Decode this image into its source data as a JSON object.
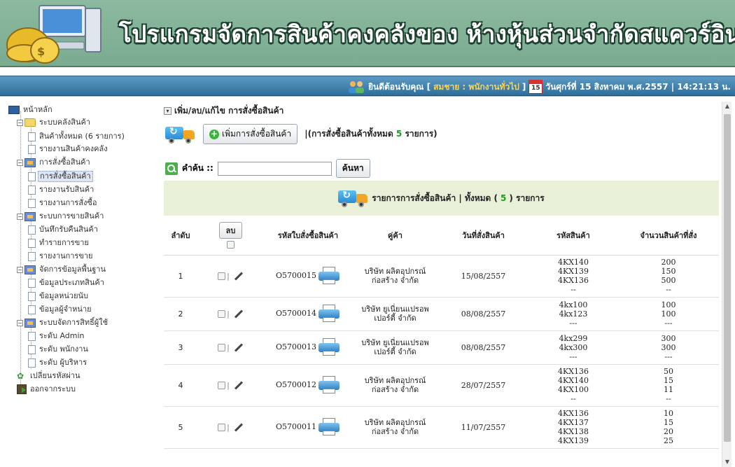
{
  "banner": {
    "title": "โปรแกรมจัดการสินค้าคงคลังของ ห้างหุ้นส่วนจำกัดสแควร์อินเตอร์เทรด"
  },
  "status": {
    "welcome_prefix": "ยินดีต้อนรับคุณ [",
    "user": "สมชาย : พนักงานทั่วไป",
    "welcome_suffix": "]",
    "calendar_day": "15",
    "datetime": "วันศุกร์ที่ 15 สิงหาคม พ.ศ.2557 | 14:21:13 น."
  },
  "sidebar": {
    "home": "หน้าหลัก",
    "groups": [
      {
        "label": "ระบบคลังสินค้า",
        "items": [
          "สินค้าทั้งหมด (6 รายการ)",
          "รายงานสินค้าคงคลัง"
        ]
      },
      {
        "label": "การสั่งซื้อสินค้า",
        "items": [
          "การสั่งซื้อสินค้า",
          "รายงานรับสินค้า",
          "รายงานการสั่งซื้อ"
        ]
      },
      {
        "label": "ระบบการขายสินค้า",
        "items": [
          "บันทึกรับคืนสินค้า",
          "ทำรายการขาย",
          "รายงานการขาย"
        ]
      },
      {
        "label": "จัดการข้อมูลพื้นฐาน",
        "items": [
          "ข้อมูลประเภทสินค้า",
          "ข้อมูลหน่วยนับ",
          "ข้อมูลผู้จำหน่าย"
        ]
      },
      {
        "label": "ระบบจัดการสิทธิ์ผู้ใช้",
        "items": [
          "ระดับ Admin",
          "ระดับ พนักงาน",
          "ระดับ ผู้บริหาร"
        ]
      }
    ],
    "change_password": "เปลี่ยนรหัสผ่าน",
    "logout": "ออกจากระบบ"
  },
  "main": {
    "breadcrumb": "เพิ่ม/ลบ/แก้ไข การสั่งซื้อสินค้า",
    "add_button": "เพิ่มการสั่งซื้อสินค้า",
    "count_prefix": "|(การสั่งซื้อสินค้าทั้งหมด",
    "count_value": "5",
    "count_suffix": "รายการ)",
    "search_label": "คำค้น ::",
    "search_value": "",
    "search_button": "ค้นหา",
    "panel_prefix": "รายการการสั่งซื้อสินค้า | ทั้งหมด (",
    "panel_count": "5",
    "panel_suffix": ") รายการ"
  },
  "table": {
    "headers": {
      "no": "ลำดับ",
      "delete": "ลบ",
      "order_id": "รหัสใบสั่งซื้อสินค้า",
      "partner": "คู่ค้า",
      "date": "วันที่สั่งสินค้า",
      "product": "รหัสสินค้า",
      "qty": "จำนวนสินค้าที่สั่ง"
    },
    "rows": [
      {
        "no": "1",
        "order_id": "O5700015",
        "partner": [
          "บริษัท ผลิตอุปกรณ์",
          "ก่อสร้าง จำกัด"
        ],
        "date": "15/08/2557",
        "products": [
          "4KX140",
          "4KX139",
          "4KX136",
          "--"
        ],
        "qty": [
          "200",
          "150",
          "500",
          "--"
        ]
      },
      {
        "no": "2",
        "order_id": "O5700014",
        "partner": [
          "บริษัท ยูเนี่ยนแปรอพ",
          "เปอร์ตี้ จำกัด"
        ],
        "date": "08/08/2557",
        "products": [
          "4kx100",
          "4kx123",
          "---"
        ],
        "qty": [
          "100",
          "100",
          "---"
        ]
      },
      {
        "no": "3",
        "order_id": "O5700013",
        "partner": [
          "บริษัท ยูเนี่ยนแปรอพ",
          "เปอร์ตี้ จำกัด"
        ],
        "date": "08/08/2557",
        "products": [
          "4kx299",
          "4kx300",
          "---"
        ],
        "qty": [
          "300",
          "300",
          "---"
        ]
      },
      {
        "no": "4",
        "order_id": "O5700012",
        "partner": [
          "บริษัท ผลิตอุปกรณ์",
          "ก่อสร้าง จำกัด"
        ],
        "date": "28/07/2557",
        "products": [
          "4KX136",
          "4KX140",
          "4KX100",
          "--"
        ],
        "qty": [
          "50",
          "15",
          "11",
          "--"
        ]
      },
      {
        "no": "5",
        "order_id": "O5700011",
        "partner": [
          "บริษัท ผลิตอุปกรณ์",
          "ก่อสร้าง จำกัด"
        ],
        "date": "11/07/2557",
        "products": [
          "4KX136",
          "4KX137",
          "4KX138",
          "4KX139"
        ],
        "qty": [
          "10",
          "15",
          "20",
          "25"
        ]
      }
    ]
  }
}
